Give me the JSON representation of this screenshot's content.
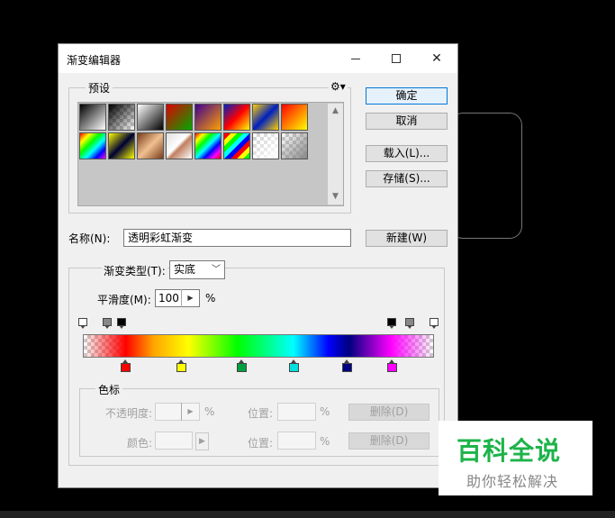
{
  "dialog": {
    "title": "渐变编辑器",
    "presets_label": "预设",
    "name_label": "名称(N):",
    "name_value": "透明彩虹渐变",
    "gradient_type_label": "渐变类型(T):",
    "gradient_type_value": "实底",
    "smoothness_label": "平滑度(M):",
    "smoothness_value": "100",
    "smoothness_unit": "%",
    "color_stop_group": "色标",
    "opacity_label": "不透明度:",
    "opacity_unit": "%",
    "location_label": "位置:",
    "location_unit": "%",
    "color_label": "颜色:",
    "buttons": {
      "ok": "确定",
      "cancel": "取消",
      "load": "载入(L)...",
      "save": "存储(S)...",
      "new": "新建(W)",
      "delete": "删除(D)"
    }
  },
  "presets": [
    "linear-gradient(135deg,#000,#fff)",
    "linear-gradient(135deg,#000,rgba(0,0,0,0))",
    "linear-gradient(135deg,#fff,#000)",
    "linear-gradient(135deg,#d00,#0a0)",
    "linear-gradient(135deg,#400090,#ffa000)",
    "linear-gradient(135deg,#0020c0,#f00 50%,#ff0)",
    "linear-gradient(135deg,#ffd000,#0020c0 50%,#ffd000)",
    "linear-gradient(135deg,#f00,#ff0)",
    "linear-gradient(135deg,#ff0000,#ffff00,#00ff00,#00ffff,#0000ff,#ff00ff)",
    "linear-gradient(135deg,#ff0,#003 50%,#ff0)",
    "linear-gradient(135deg,#7a3c1a,#f0c090 50%,#7a3c1a)",
    "linear-gradient(135deg,#e0e0e0,#fff 45%,#c08060 55%,#fff)",
    "linear-gradient(135deg,#f00,#ff0,#0f0,#0ff,#00f,#f0f,#f00)",
    "repeating-linear-gradient(135deg,#f00 0 5px,#ff0 5px 10px,#0f0 10px 15px,#0ff 15px 20px,#00f 20px 25px)",
    "linear-gradient(135deg,rgba(255,255,255,0),#fff)",
    "linear-gradient(135deg,rgba(120,120,120,0),#888)"
  ],
  "gradient_bar": {
    "opacity_stops": [
      {
        "location_pct": 0,
        "fill": "#fff"
      },
      {
        "location_pct": 7,
        "fill": "#888"
      },
      {
        "location_pct": 11,
        "fill": "#000"
      },
      {
        "location_pct": 88,
        "fill": "#000"
      },
      {
        "location_pct": 93,
        "fill": "#888"
      },
      {
        "location_pct": 100,
        "fill": "#fff"
      }
    ],
    "color_stops": [
      {
        "location_pct": 12,
        "color": "#ff0000"
      },
      {
        "location_pct": 28,
        "color": "#ffff00"
      },
      {
        "location_pct": 45,
        "color": "#00a040"
      },
      {
        "location_pct": 60,
        "color": "#00e0e0"
      },
      {
        "location_pct": 75,
        "color": "#000080"
      },
      {
        "location_pct": 88,
        "color": "#ff00ff"
      }
    ]
  },
  "watermark": {
    "title": "百科全说",
    "subtitle": "助你轻松解决"
  },
  "colors": {
    "accent": "#0078d7",
    "watermark_green": "#1db34a"
  }
}
